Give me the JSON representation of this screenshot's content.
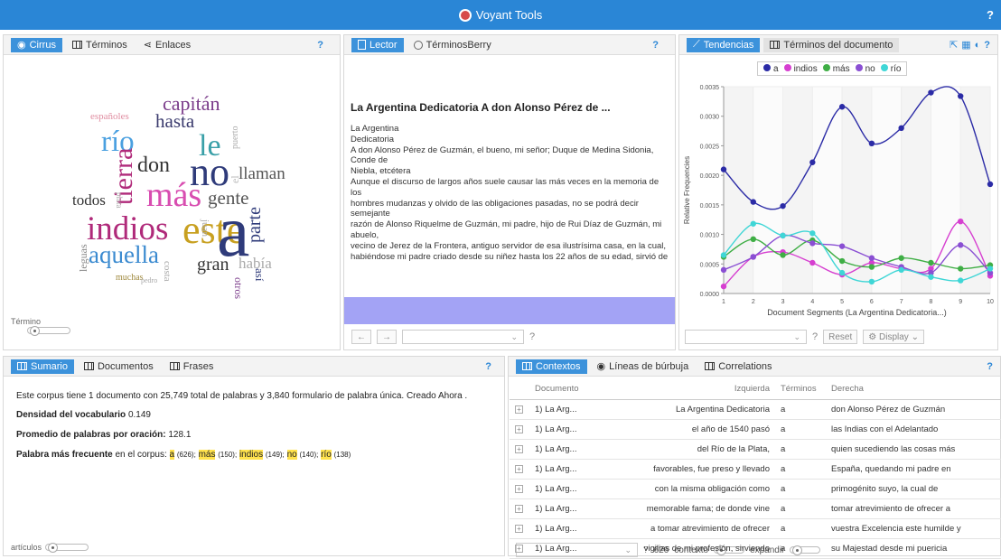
{
  "app": {
    "title": "Voyant Tools",
    "help": "?"
  },
  "cirrus": {
    "tabs": [
      {
        "label": "Cirrus"
      },
      {
        "label": "Términos"
      },
      {
        "label": "Enlaces"
      }
    ],
    "help": "?",
    "slider_label": "Término",
    "words": [
      "capitán",
      "hasta",
      "españoles",
      "río",
      "le",
      "don",
      "no",
      "llaman",
      "tierra",
      "más",
      "gente",
      "todos",
      "indios",
      "este",
      "parte",
      "a",
      "aquella",
      "gran",
      "había",
      "así",
      "muchas",
      "costa",
      "juan",
      "otros",
      "leguas",
      "puerto",
      "el",
      "plata",
      "pedro"
    ]
  },
  "reader": {
    "tabs": [
      {
        "label": "Lector"
      },
      {
        "label": "TérminosBerry"
      }
    ],
    "help": "?",
    "title": "La Argentina Dedicatoria A don Alonso Pérez de ...",
    "lines": [
      "La Argentina",
      "Dedicatoria",
      "A don Alonso Pérez de Guzmán, el bueno, mi señor; Duque de Medina Sidonia, Conde de",
      "Niebla, etcétera",
      "Aunque el discurso de largos años suele causar las más veces en la memoria de los",
      "hombres mudanzas y olvido de las obligaciones pasadas, no se podrá decir semejante",
      "razón de Alonso Riquelme de Guzmán, mi padre, hijo de Rui Díaz de Guzmán, mi abuelo,",
      "vecino de Jerez de la Frontera, antiguo servidor de esa ilustrísima casa, en la cual,",
      "habiéndose mi padre criado desde su niñez hasta los 22 años de su edad, sirvió de"
    ],
    "back": "←",
    "forward": "→",
    "combo_help": "?"
  },
  "trends": {
    "tabs": [
      {
        "label": "Tendencias"
      },
      {
        "label": "Términos del documento"
      }
    ],
    "help": "?",
    "reset": "Reset",
    "display": "Display",
    "combo_help": "?",
    "legend": [
      {
        "name": "a",
        "color": "#2b2ba6"
      },
      {
        "name": "indios",
        "color": "#d63fd0"
      },
      {
        "name": "más",
        "color": "#3fae45"
      },
      {
        "name": "no",
        "color": "#8a4fd3"
      },
      {
        "name": "río",
        "color": "#3fd6d6"
      }
    ]
  },
  "chart_data": {
    "type": "line",
    "xlabel": "Document Segments (La Argentina Dedicatoria...)",
    "ylabel": "Relative Frequencies",
    "x": [
      1,
      2,
      3,
      4,
      5,
      6,
      7,
      8,
      9,
      10
    ],
    "ylim": [
      0,
      0.0035
    ],
    "yticks": [
      "0.0000",
      "0.0005",
      "0.0010",
      "0.0015",
      "0.0020",
      "0.0025",
      "0.0030",
      "0.0035"
    ],
    "series": [
      {
        "name": "a",
        "color": "#2b2ba6",
        "values": [
          0.0021,
          0.00155,
          0.00148,
          0.00222,
          0.00316,
          0.00254,
          0.0028,
          0.0034,
          0.00334,
          0.00185
        ]
      },
      {
        "name": "indios",
        "color": "#d63fd0",
        "values": [
          0.00012,
          0.00062,
          0.0007,
          0.00052,
          0.00032,
          0.00052,
          0.00042,
          0.00042,
          0.00122,
          0.0003
        ]
      },
      {
        "name": "más",
        "color": "#3fae45",
        "values": [
          0.00062,
          0.00092,
          0.00065,
          0.0009,
          0.00055,
          0.00045,
          0.0006,
          0.00052,
          0.00042,
          0.00048
        ]
      },
      {
        "name": "no",
        "color": "#8a4fd3",
        "values": [
          0.0004,
          0.00062,
          0.00098,
          0.00085,
          0.0008,
          0.0006,
          0.00045,
          0.00035,
          0.00082,
          0.00035
        ]
      },
      {
        "name": "río",
        "color": "#3fd6d6",
        "values": [
          0.00065,
          0.00118,
          0.00098,
          0.00102,
          0.00035,
          0.0002,
          0.0004,
          0.00028,
          0.00022,
          0.00042
        ]
      }
    ]
  },
  "summary": {
    "tabs": [
      {
        "label": "Sumario"
      },
      {
        "label": "Documentos"
      },
      {
        "label": "Frases"
      }
    ],
    "help": "?",
    "line1": "Este corpus tiene 1 documento con 25,749 total de palabras y 3,840 formulario de palabra única. Creado Ahora .",
    "density_label": "Densidad del vocabulario",
    "density_value": "0.149",
    "avg_label": "Promedio de palabras por oración:",
    "avg_value": "128.1",
    "freq_label": "Palabra más frecuente",
    "freq_suffix": "en el corpus:",
    "freq": [
      {
        "w": "a",
        "c": "(626);"
      },
      {
        "w": "más",
        "c": "(150);"
      },
      {
        "w": "indios",
        "c": "(149);"
      },
      {
        "w": "no",
        "c": "(140);"
      },
      {
        "w": "río",
        "c": "(138)"
      }
    ],
    "slider_label": "artículos"
  },
  "contexts": {
    "tabs": [
      {
        "label": "Contextos"
      },
      {
        "label": "Líneas de búrbuja"
      },
      {
        "label": "Correlations"
      }
    ],
    "help": "?",
    "headers": [
      "Documento",
      "Izquierda",
      "Términos",
      "Derecha"
    ],
    "rows": [
      [
        "1) La Arg...",
        "La Argentina Dedicatoria",
        "a",
        "don Alonso Pérez de Guzmán"
      ],
      [
        "1) La Arg...",
        "el año de 1540 pasó",
        "a",
        "las Indias con el Adelantado"
      ],
      [
        "1) La Arg...",
        "del Río de la Plata,",
        "a",
        "quien sucediendo las cosas más"
      ],
      [
        "1) La Arg...",
        "favorables, fue preso y llevado",
        "a",
        "España, quedando mi padre en"
      ],
      [
        "1) La Arg...",
        "con la misma obligación como",
        "a",
        "primogénito suyo, la cual de"
      ],
      [
        "1) La Arg...",
        "memorable fama; de donde vine",
        "a",
        "tomar atrevimiento de ofrecer a"
      ],
      [
        "1) La Arg...",
        "a tomar atrevimiento de ofrecer",
        "a",
        "vuestra Excelencia este humilde y"
      ],
      [
        "1) La Arg...",
        "vigilias de mi profesión, sirviendo",
        "a",
        "su Majestad desde mi puericia"
      ]
    ],
    "footer": {
      "help": "?",
      "count": "626",
      "context": "contexto",
      "expand": "expandir"
    }
  }
}
